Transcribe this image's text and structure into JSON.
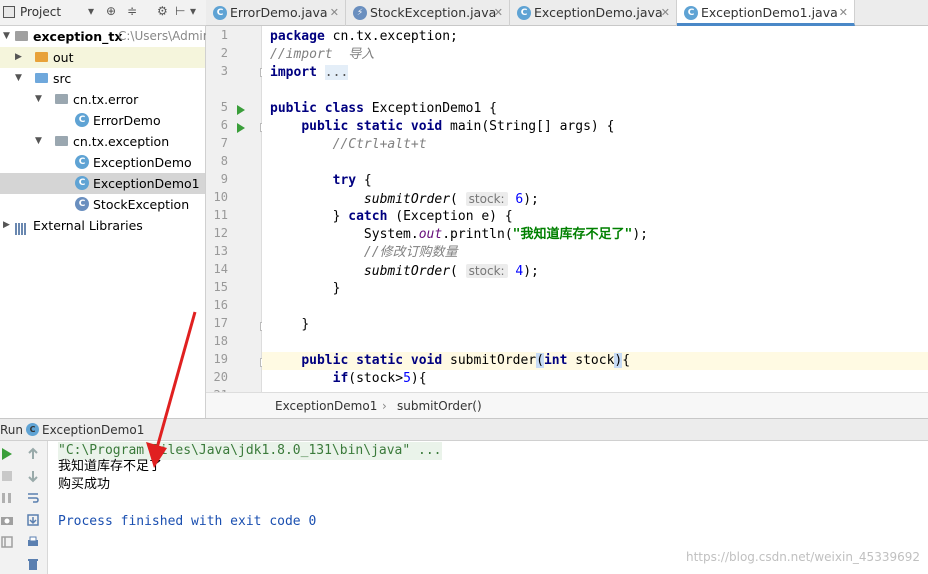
{
  "project_panel": {
    "title": "Project",
    "tree": [
      {
        "label": "exception_tx",
        "extra": "C:\\Users\\Admir"
      },
      {
        "label": "out"
      },
      {
        "label": "src"
      },
      {
        "label": "cn.tx.error"
      },
      {
        "label": "ErrorDemo"
      },
      {
        "label": "cn.tx.exception"
      },
      {
        "label": "ExceptionDemo"
      },
      {
        "label": "ExceptionDemo1"
      },
      {
        "label": "StockException"
      },
      {
        "label": "External Libraries"
      }
    ]
  },
  "tabs": [
    {
      "label": "ErrorDemo.java"
    },
    {
      "label": "StockException.java"
    },
    {
      "label": "ExceptionDemo.java"
    },
    {
      "label": "ExceptionDemo1.java"
    }
  ],
  "editor": {
    "line_numbers": [
      "1",
      "2",
      "3",
      "5",
      "6",
      "7",
      "8",
      "9",
      "10",
      "11",
      "12",
      "13",
      "14",
      "15",
      "16",
      "17",
      "18",
      "19",
      "20",
      "21"
    ],
    "code": {
      "l1": {
        "kw": "package",
        "rest": " cn.tx.exception;"
      },
      "l2": {
        "cm": "//import  导入"
      },
      "l3": {
        "kw": "import",
        "fold": "..."
      },
      "l6": {
        "kw": "public class",
        "rest": " ExceptionDemo1 {"
      },
      "l7": {
        "kw": "public static void",
        "rest": " main(String[] args) {"
      },
      "l8": {
        "cm": "//Ctrl+alt+t"
      },
      "l10": {
        "kw": "try",
        "rest": " {"
      },
      "l11": {
        "method": "submitOrder",
        "hint": "stock:",
        "num": "6",
        "end": ");"
      },
      "l12": {
        "pre": "} ",
        "kw": "catch",
        "rest": " (Exception e) {"
      },
      "l13": {
        "cls": "System.",
        "field": "out",
        "call": ".println(",
        "str": "\"我知道库存不足了\"",
        "end": ");"
      },
      "l14": {
        "cm": "//修改订购数量"
      },
      "l15": {
        "method": "submitOrder",
        "hint": "stock:",
        "num": "4",
        "end": ");"
      },
      "l16": {
        "rest": "}"
      },
      "l18": {
        "rest": "}"
      },
      "l20": {
        "kw": "public static void",
        "method": "submitOrder",
        "kw2": "int",
        "param": " stock",
        "end": "{"
      },
      "l21": {
        "kw": "if",
        "rest": "(stock>",
        "num": "5",
        "end": "){"
      }
    },
    "breadcrumb": [
      "ExceptionDemo1",
      "submitOrder()"
    ]
  },
  "run_panel": {
    "label": "Run",
    "config": "ExceptionDemo1",
    "console": [
      "\"C:\\Program Files\\Java\\jdk1.8.0_131\\bin\\java\" ...",
      "我知道库存不足了",
      "购买成功",
      "",
      "Process finished with exit code 0"
    ]
  },
  "watermark": "https://blog.csdn.net/weixin_45339692",
  "colors": {
    "accent": "#4a88c7",
    "run_green": "#3a9e3a",
    "annotation_red": "#e02020"
  }
}
